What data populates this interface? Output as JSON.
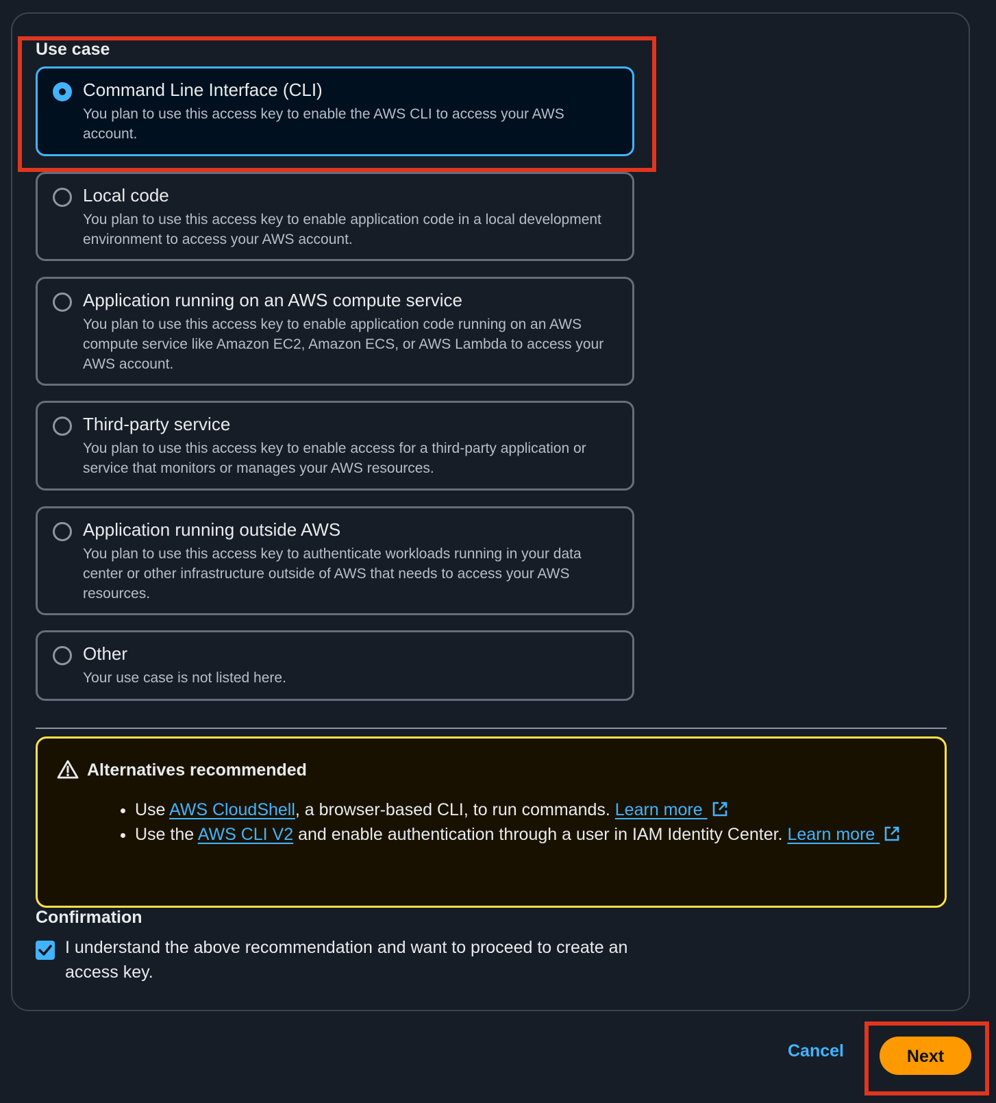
{
  "use_case": {
    "label": "Use case",
    "options": [
      {
        "title": "Command Line Interface (CLI)",
        "description": "You plan to use this access key to enable the AWS CLI to access your AWS account.",
        "selected": true
      },
      {
        "title": "Local code",
        "description": "You plan to use this access key to enable application code in a local development environment to access your AWS account.",
        "selected": false
      },
      {
        "title": "Application running on an AWS compute service",
        "description": "You plan to use this access key to enable application code running on an AWS compute service like Amazon EC2, Amazon ECS, or AWS Lambda to access your AWS account.",
        "selected": false
      },
      {
        "title": "Third-party service",
        "description": "You plan to use this access key to enable access for a third-party application or service that monitors or manages your AWS resources.",
        "selected": false
      },
      {
        "title": "Application running outside AWS",
        "description": "You plan to use this access key to authenticate workloads running in your data center or other infrastructure outside of AWS that needs to access your AWS resources.",
        "selected": false
      },
      {
        "title": "Other",
        "description": "Your use case is not listed here.",
        "selected": false
      }
    ]
  },
  "alert": {
    "title": "Alternatives recommended",
    "items": [
      {
        "prefix": "Use ",
        "link": "AWS CloudShell",
        "middle": ", a browser-based CLI, to run commands. ",
        "learn_more": "Learn more"
      },
      {
        "prefix": "Use the ",
        "link": "AWS CLI V2",
        "middle": " and enable authentication through a user in IAM Identity Center. ",
        "learn_more": "Learn more"
      }
    ]
  },
  "confirmation": {
    "label": "Confirmation",
    "checked": true,
    "text": "I understand the above recommendation and want to proceed to create an access key."
  },
  "footer": {
    "cancel_label": "Cancel",
    "next_label": "Next"
  },
  "colors": {
    "accent": "#42b4ff",
    "primary_button": "#ff9900",
    "warning_border": "#ffe347",
    "annotation_red": "#e0361f"
  }
}
